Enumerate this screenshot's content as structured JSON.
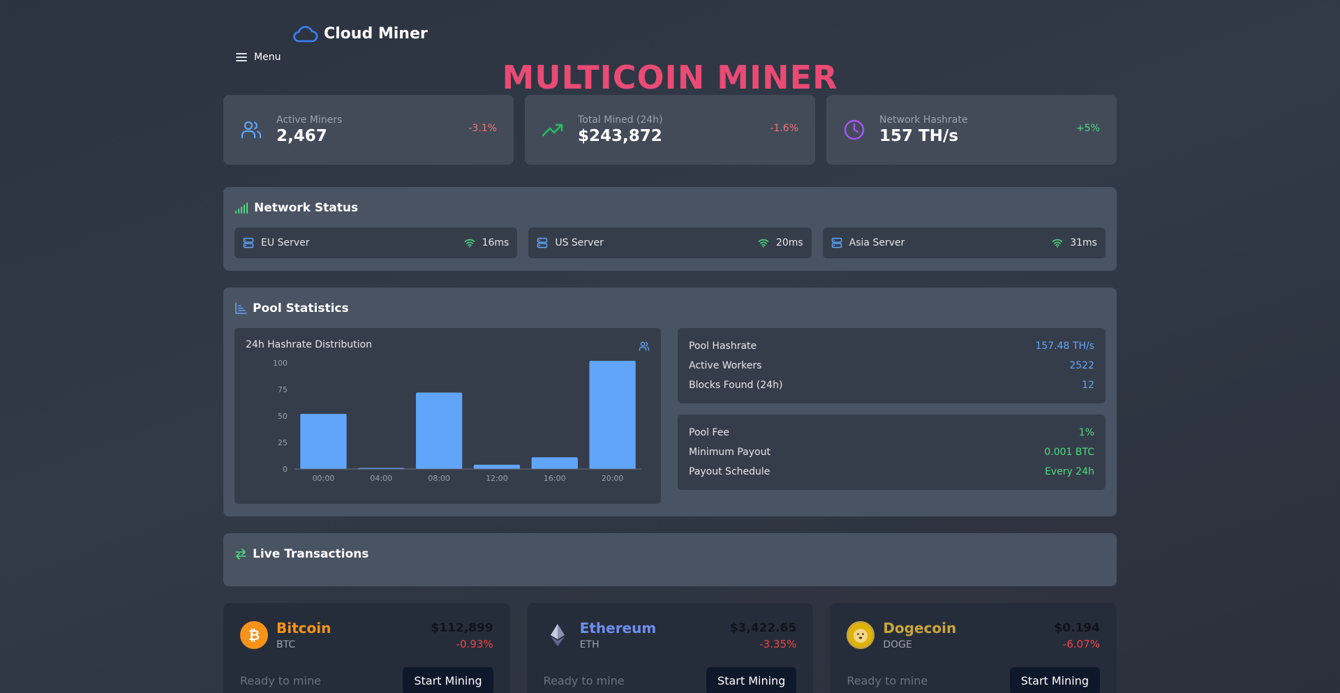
{
  "brand": {
    "name": "Cloud Miner"
  },
  "menu": {
    "label": "Menu"
  },
  "hero": {
    "title": "MULTICOIN MINER"
  },
  "stats": [
    {
      "label": "Active Miners",
      "value": "2,467",
      "change": "-3.1%",
      "icon": "users-icon"
    },
    {
      "label": "Total Mined (24h)",
      "value": "$243,872",
      "change": "-1.6%",
      "icon": "trending-up-icon"
    },
    {
      "label": "Network Hashrate",
      "value": "157 TH/s",
      "change": "+5%",
      "icon": "clock-icon"
    }
  ],
  "network": {
    "title": "Network Status",
    "servers": [
      {
        "name": "EU Server",
        "ping": "16ms"
      },
      {
        "name": "US Server",
        "ping": "20ms"
      },
      {
        "name": "Asia Server",
        "ping": "31ms"
      }
    ]
  },
  "pool": {
    "title": "Pool Statistics",
    "stats": [
      {
        "label": "Pool Hashrate",
        "value": "157.48 TH/s"
      },
      {
        "label": "Active Workers",
        "value": "2522"
      },
      {
        "label": "Blocks Found (24h)",
        "value": "12"
      }
    ],
    "fees": [
      {
        "label": "Pool Fee",
        "value": "1%"
      },
      {
        "label": "Minimum Payout",
        "value": "0.001 BTC"
      },
      {
        "label": "Payout Schedule",
        "value": "Every 24h"
      }
    ]
  },
  "chart_data": {
    "type": "bar",
    "title": "24h Hashrate Distribution",
    "categories": [
      "00:00",
      "04:00",
      "08:00",
      "12:00",
      "16:00",
      "20:00"
    ],
    "values": [
      52,
      1,
      72,
      4,
      11,
      102
    ],
    "yticks": [
      "0",
      "25",
      "50",
      "75",
      "100"
    ],
    "ylim": [
      0,
      100
    ],
    "color": "#60a5fa"
  },
  "transactions": {
    "title": "Live Transactions"
  },
  "coins": [
    {
      "name": "Bitcoin",
      "symbol": "BTC",
      "price": "$112,899",
      "change": "-0.93%",
      "status": "Ready to mine",
      "button": "Start Mining",
      "color": "#f7931a"
    },
    {
      "name": "Ethereum",
      "symbol": "ETH",
      "price": "$3,422.65",
      "change": "-3.35%",
      "status": "Ready to mine",
      "button": "Start Mining",
      "color": "#6f8ef0"
    },
    {
      "name": "Dogecoin",
      "symbol": "DOGE",
      "price": "$0.194",
      "change": "-6.07%",
      "status": "Ready to mine",
      "button": "Start Mining",
      "color": "#c9a53a"
    }
  ]
}
